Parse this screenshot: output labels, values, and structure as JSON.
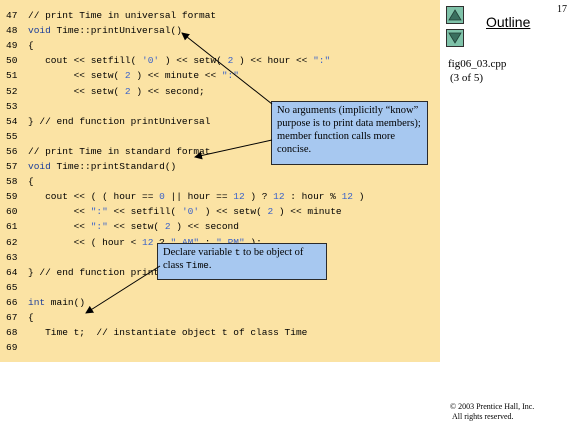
{
  "slide": {
    "page_number": "17",
    "outline_label": "Outline",
    "file_name": "fig06_03.cpp",
    "part": "(3 of 5)",
    "copyright_line1": "© 2003 Prentice Hall, Inc.",
    "copyright_line2": "All rights reserved."
  },
  "nav": {
    "up_icon": "triangle-up-icon",
    "down_icon": "triangle-down-icon"
  },
  "code_lines": [
    {
      "n": "47",
      "html": "<span class=\"cm\">// print Time in universal format</span>"
    },
    {
      "n": "48",
      "html": "<span class=\"kw\">void</span> Time::printUniversal()"
    },
    {
      "n": "49",
      "html": "{"
    },
    {
      "n": "50",
      "html": "   cout &lt;&lt; setfill( <span class=\"str\">'0'</span> ) &lt;&lt; setw( <span class=\"num\">2</span> ) &lt;&lt; hour &lt;&lt; <span class=\"str\">\":\"</span>"
    },
    {
      "n": "51",
      "html": "        &lt;&lt; setw( <span class=\"num\">2</span> ) &lt;&lt; minute &lt;&lt; <span class=\"str\">\":\"</span>"
    },
    {
      "n": "52",
      "html": "        &lt;&lt; setw( <span class=\"num\">2</span> ) &lt;&lt; second;"
    },
    {
      "n": "53",
      "html": ""
    },
    {
      "n": "54",
      "html": "} <span class=\"cm\">// end function printUniversal</span>"
    },
    {
      "n": "55",
      "html": ""
    },
    {
      "n": "56",
      "html": "<span class=\"cm\">// print Time in standard format</span>"
    },
    {
      "n": "57",
      "html": "<span class=\"kw\">void</span> Time::printStandard()"
    },
    {
      "n": "58",
      "html": "{"
    },
    {
      "n": "59",
      "html": "   cout &lt;&lt; ( ( hour == <span class=\"num\">0</span> || hour == <span class=\"num\">12</span> ) ? <span class=\"num\">12</span> : hour % <span class=\"num\">12</span> )"
    },
    {
      "n": "60",
      "html": "        &lt;&lt; <span class=\"str\">\":\"</span> &lt;&lt; setfill( <span class=\"str\">'0'</span> ) &lt;&lt; setw( <span class=\"num\">2</span> ) &lt;&lt; minute"
    },
    {
      "n": "61",
      "html": "        &lt;&lt; <span class=\"str\">\":\"</span> &lt;&lt; setw( <span class=\"num\">2</span> ) &lt;&lt; second"
    },
    {
      "n": "62",
      "html": "        &lt;&lt; ( hour &lt; <span class=\"num\">12</span> ? <span class=\"str\">\" AM\"</span> : <span class=\"str\">\" PM\"</span> );"
    },
    {
      "n": "63",
      "html": ""
    },
    {
      "n": "64",
      "html": "} <span class=\"cm\">// end function printStandard</span>"
    },
    {
      "n": "65",
      "html": ""
    },
    {
      "n": "66",
      "html": "<span class=\"kw\">int</span> main()"
    },
    {
      "n": "67",
      "html": "{"
    },
    {
      "n": "68",
      "html": "   Time t;  <span class=\"cm\">// instantiate object t of class Time</span>"
    },
    {
      "n": "69",
      "html": ""
    }
  ],
  "callouts": {
    "no_args_text": "No arguments (implicitly “know” purpose is to print data members); member function calls more concise.",
    "declare_prefix": "Declare variable ",
    "declare_var": "t",
    "declare_middle": " to be object of class ",
    "declare_class": "Time",
    "declare_suffix": "."
  },
  "colors": {
    "code_background": "#fbe3a4",
    "callout_background": "#a7c8f0",
    "nav_button": "#7fc2a9"
  }
}
